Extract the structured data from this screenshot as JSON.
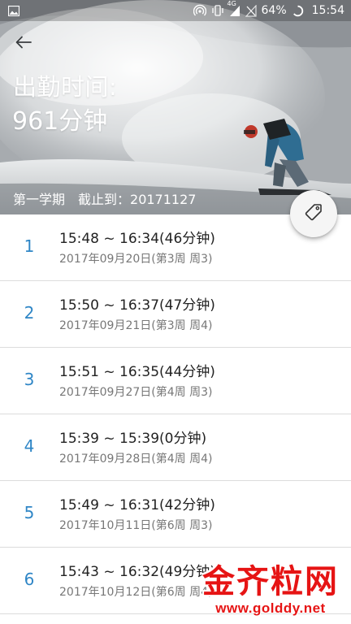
{
  "status_bar": {
    "battery_percent": "64%",
    "clock": "15:54",
    "network_label": "4G",
    "icons": [
      "image-icon",
      "hotspot-icon",
      "vibrate-icon",
      "signal-icon",
      "no-sim-icon",
      "battery-icon"
    ]
  },
  "header": {
    "back_icon": "arrow-left-icon",
    "attendance_label": "出勤时间:",
    "attendance_value": "961分钟",
    "semester": "第一学期",
    "cutoff": "截止到：20171127",
    "fab_icon": "tag-icon",
    "accent_color": "#2f86c6"
  },
  "records": [
    {
      "index": "1",
      "time": "15:48 ~ 16:34(46分钟)",
      "date": "2017年09月20日(第3周 周3)"
    },
    {
      "index": "2",
      "time": "15:50 ~ 16:37(47分钟)",
      "date": "2017年09月21日(第3周 周4)"
    },
    {
      "index": "3",
      "time": "15:51 ~ 16:35(44分钟)",
      "date": "2017年09月27日(第4周 周3)"
    },
    {
      "index": "4",
      "time": "15:39 ~ 15:39(0分钟)",
      "date": "2017年09月28日(第4周 周4)"
    },
    {
      "index": "5",
      "time": "15:49 ~ 16:31(42分钟)",
      "date": "2017年10月11日(第6周 周3)"
    },
    {
      "index": "6",
      "time": "15:43 ~ 16:32(49分钟)",
      "date": "2017年10月12日(第6周 周4)"
    }
  ],
  "watermark": {
    "main": "金齐粒网",
    "url": "www.golddy.net",
    "color": "#e61414"
  }
}
